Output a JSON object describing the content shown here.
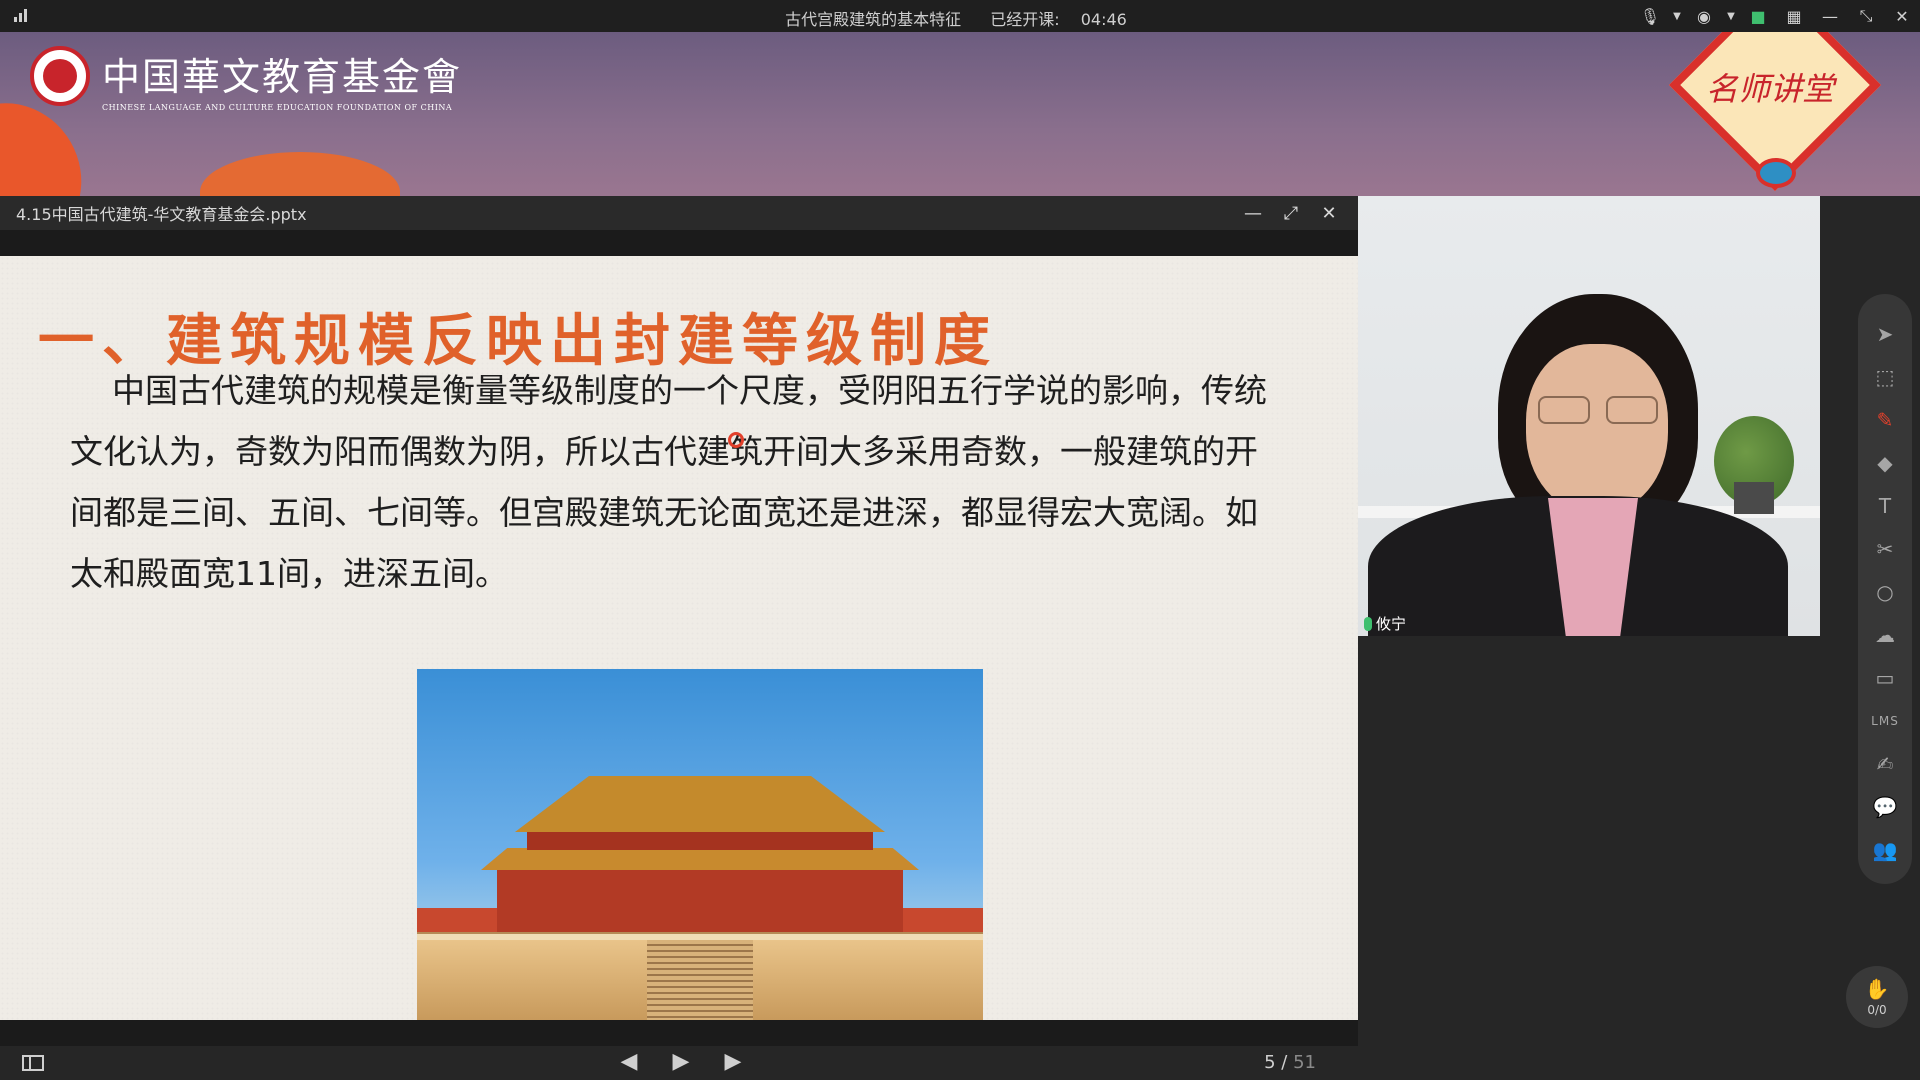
{
  "topbar": {
    "course_title": "古代宫殿建筑的基本特征",
    "elapsed_label": "已经开课:",
    "elapsed_time": "04:46",
    "icons": [
      "mic-icon",
      "chevron-down-icon",
      "location-icon",
      "chevron-down-icon",
      "camera-icon",
      "grid-icon",
      "minimize-icon",
      "restore-icon",
      "close-icon"
    ]
  },
  "banner": {
    "org_name_cn": "中国華文教育基金會",
    "org_name_en": "CHINESE LANGUAGE AND CULTURE EDUCATION FOUNDATION OF CHINA",
    "badge_text": "名师讲堂",
    "colors": {
      "accent_red": "#d9302b",
      "banner_purple": "#7f6a86"
    }
  },
  "presentation": {
    "file_name": "4.15中国古代建筑-华文教育基金会.pptx",
    "slide_title": "一、建筑规模反映出封建等级制度",
    "slide_body": "中国古代建筑的规模是衡量等级制度的一个尺度，受阴阳五行学说的影响，传统文化认为，奇数为阳而偶数为阴，所以古代建筑开间大多采用奇数，一般建筑的开间都是三间、五间、七间等。但宫殿建筑无论面宽还是进深，都显得宏大宽阔。如太和殿面宽11间，进深五间。",
    "current_page": "5",
    "separator": "/",
    "total_pages": "51",
    "float_icon_label": "P"
  },
  "video": {
    "speaker_name": "攸宁"
  },
  "toolstrip": {
    "tools": [
      "pointer-icon",
      "select-area-icon",
      "pen-icon",
      "eraser-icon",
      "text-icon",
      "scissors-icon",
      "shape-icon",
      "cloud-icon",
      "toolbox-icon",
      "lms-icon",
      "edit-icon",
      "chat-icon",
      "users-icon"
    ],
    "lms_label": "LMS"
  },
  "handraise": {
    "count": "0/0"
  }
}
